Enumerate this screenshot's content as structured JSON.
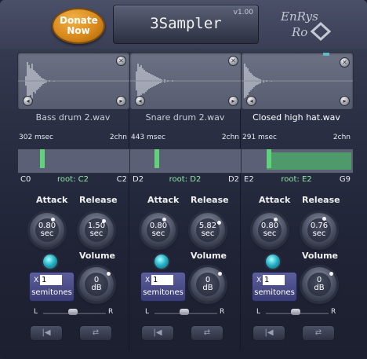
{
  "header": {
    "donate_label": "Donate Now",
    "app_title": "3Sampler",
    "version": "v1.00",
    "logo_line1": "EnRys",
    "logo_line2": "Ro"
  },
  "labels": {
    "attack": "Attack",
    "release": "Release",
    "volume": "Volume",
    "semitones": "semitones",
    "times": "X",
    "pan_left": "L",
    "pan_right": "R",
    "sec_unit": "sec",
    "db_unit": "dB"
  },
  "channels": [
    {
      "file_name": "Bass drum 2.wav",
      "file_name_color": "#c8ccd8",
      "duration": "302 msec",
      "channels": "2chn",
      "key_low": "C0",
      "root": "root: C2",
      "key_high": "C2",
      "attack": "0.80",
      "release": "1.50",
      "volume": "0",
      "semitones": "1",
      "pan": 0.5
    },
    {
      "file_name": "Snare drum 2.wav",
      "file_name_color": "#c8ccd8",
      "duration": "443 msec",
      "channels": "2chn",
      "key_low": "D2",
      "root": "root: D2",
      "key_high": "D2",
      "attack": "0.80",
      "release": "5.82",
      "volume": "0",
      "semitones": "1",
      "pan": 0.5
    },
    {
      "file_name": "Closed high hat.wav",
      "file_name_color": "#ffffff",
      "duration": "291 msec",
      "channels": "2chn",
      "key_low": "E2",
      "root": "root: E2",
      "key_high": "G9",
      "attack": "0.80",
      "release": "0.76",
      "volume": "0",
      "semitones": "1",
      "pan": 0.5
    }
  ],
  "colors": {
    "accent_green": "#5fd27a",
    "donate_orange": "#d98a1c",
    "led_cyan": "#28b4c8"
  }
}
